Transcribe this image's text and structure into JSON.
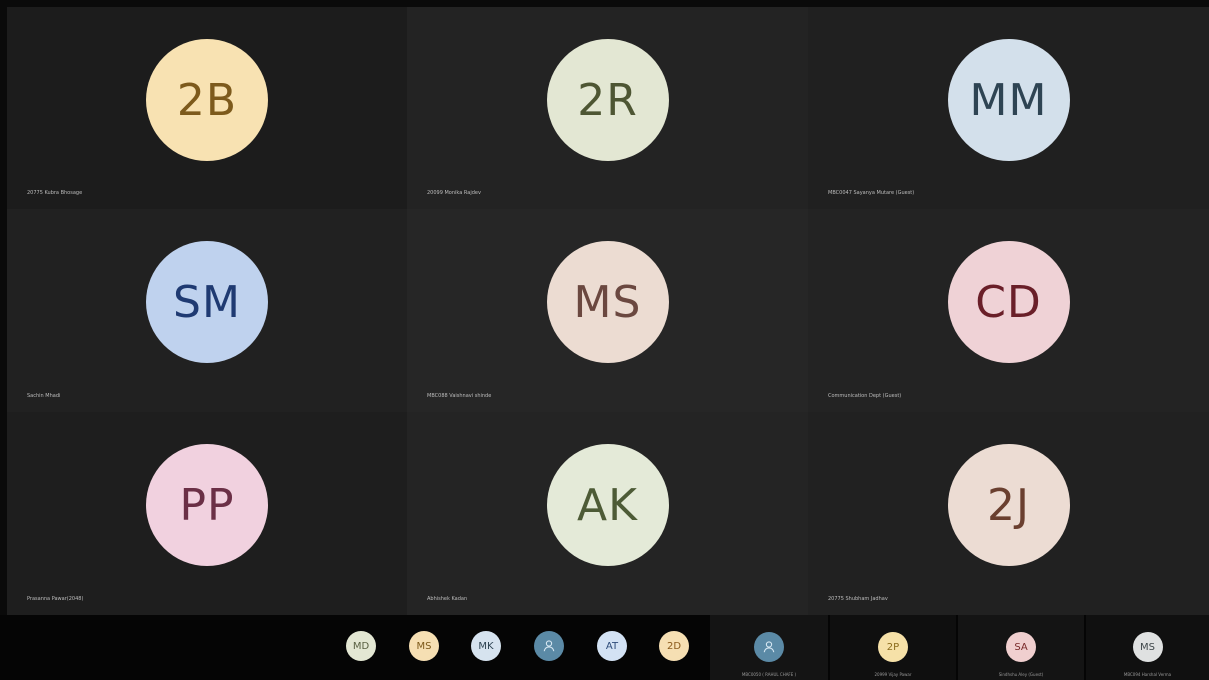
{
  "colors": {
    "c2B_bg": "#f8e2b2",
    "c2B_fg": "#7d5a1c",
    "c2R_bg": "#e3e7d3",
    "c2R_fg": "#4e5633",
    "cMM_bg": "#d3e0eb",
    "cMM_fg": "#2e4453",
    "cSM_bg": "#bfd2ee",
    "cSM_fg": "#1f3a72",
    "cMS_bg": "#ecdcd2",
    "cMS_fg": "#6b4840",
    "cCD_bg": "#efd2d6",
    "cCD_fg": "#6a1f29",
    "cPP_bg": "#f1d1df",
    "cPP_fg": "#6b2f46",
    "cAK_bg": "#e4ead8",
    "cAK_fg": "#4d5b36",
    "c2J_bg": "#ecdcd3",
    "c2J_fg": "#6a3f2f"
  },
  "grid": {
    "tiles": [
      {
        "initials": "2B",
        "name": "20775 Kubra Bhosage",
        "bg": "#f8e2b2",
        "fg": "#7d5a1c"
      },
      {
        "initials": "2R",
        "name": "20099 Monika Rajdev",
        "bg": "#e3e7d3",
        "fg": "#4e5633"
      },
      {
        "initials": "MM",
        "name": "MBC0047 Sayanya Mutare (Guest)",
        "bg": "#d3e0eb",
        "fg": "#2e4453"
      },
      {
        "initials": "SM",
        "name": "Sachin Mhadi",
        "bg": "#bfd2ee",
        "fg": "#1f3a72"
      },
      {
        "initials": "MS",
        "name": "MBC088 Vaishnavi shinde",
        "bg": "#ecdcd2",
        "fg": "#6b4840"
      },
      {
        "initials": "CD",
        "name": "Communication Dept (Guest)",
        "bg": "#efd2d6",
        "fg": "#6a1f29"
      },
      {
        "initials": "PP",
        "name": "Prasanna Pawar(2048)",
        "bg": "#f1d1df",
        "fg": "#6b2f46"
      },
      {
        "initials": "AK",
        "name": "Abhishek Kadan",
        "bg": "#e4ead8",
        "fg": "#4d5b36"
      },
      {
        "initials": "2J",
        "name": "20775 Shubham Jadhav",
        "bg": "#ecdcd3",
        "fg": "#6a3f2f"
      }
    ]
  },
  "strip": {
    "avatars": [
      {
        "initials": "MD",
        "bg": "#e3e7d3",
        "fg": "#5a6143"
      },
      {
        "initials": "MS",
        "bg": "#f6dfb3",
        "fg": "#7d5a1c"
      },
      {
        "initials": "MK",
        "bg": "#d6e3ef",
        "fg": "#2e4453"
      },
      {
        "initials": "",
        "icon": "person-icon",
        "bg": "#5b8aa6",
        "fg": "#d6e7f2"
      },
      {
        "initials": "AT",
        "bg": "#d3e2f4",
        "fg": "#2e4c7a"
      },
      {
        "initials": "2D",
        "bg": "#f6dfb3",
        "fg": "#8a5a1c"
      }
    ],
    "tiles": [
      {
        "initials": "",
        "icon": "person-icon",
        "name": "MBC0050 ( RAHUL CHAFE )",
        "bg": "#5b8aa6",
        "fg": "#d6e7f2"
      },
      {
        "initials": "2P",
        "name": "20999 Vijay Pawar",
        "bg": "#f6e1a8",
        "fg": "#8a6b1c"
      },
      {
        "initials": "SA",
        "name": "Sindhshu Aley (Guest)",
        "bg": "#f0cfcf",
        "fg": "#7a2b2b"
      },
      {
        "initials": "MS",
        "name": "MBC094 Harshal Verma",
        "bg": "#dfe1e1",
        "fg": "#40484b"
      }
    ]
  }
}
